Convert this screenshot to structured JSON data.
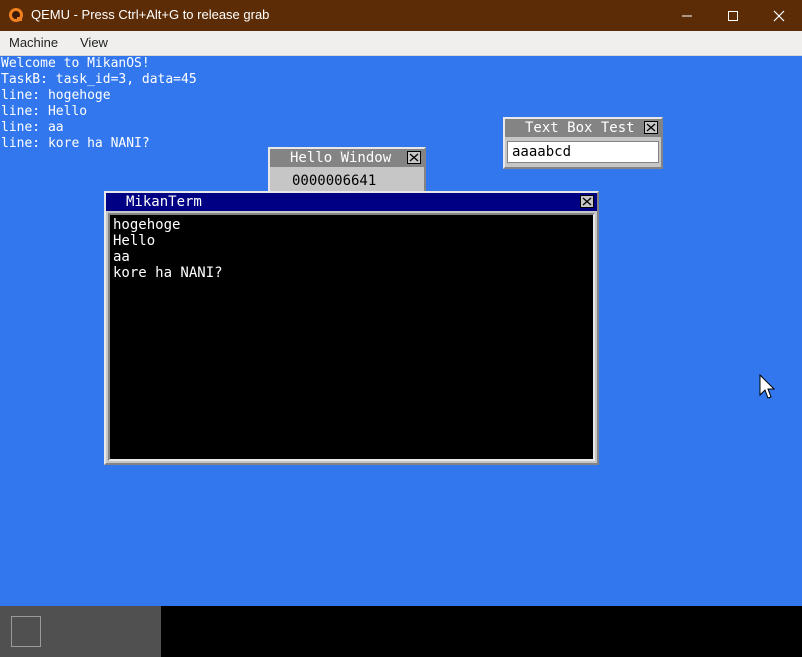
{
  "host": {
    "title": "QEMU - Press Ctrl+Alt+G to release grab",
    "menu": [
      "Machine",
      "View"
    ]
  },
  "console": {
    "lines": [
      "Welcome to MikanOS!",
      "TaskB: task_id=3, data=45",
      "line: hogehoge",
      "line: Hello",
      "line: aa",
      "line: kore ha NANI?"
    ]
  },
  "hello_window": {
    "title": "Hello Window",
    "counter": "0000006641"
  },
  "textbox_window": {
    "title": "Text Box Test",
    "value": "aaaabcd"
  },
  "terminal": {
    "title": "MikanTerm",
    "lines": [
      "hogehoge",
      "Hello",
      "aa",
      "kore ha NANI?"
    ]
  },
  "colors": {
    "desktop": "#3277ee",
    "host_titlebar": "#5c2c06",
    "active_title": "#000084",
    "inactive_title": "#848484"
  },
  "icons": {
    "app": "qemu-icon",
    "minimize": "minimize-icon",
    "maximize": "maximize-icon",
    "close": "close-icon",
    "cursor": "mouse-cursor-icon"
  }
}
